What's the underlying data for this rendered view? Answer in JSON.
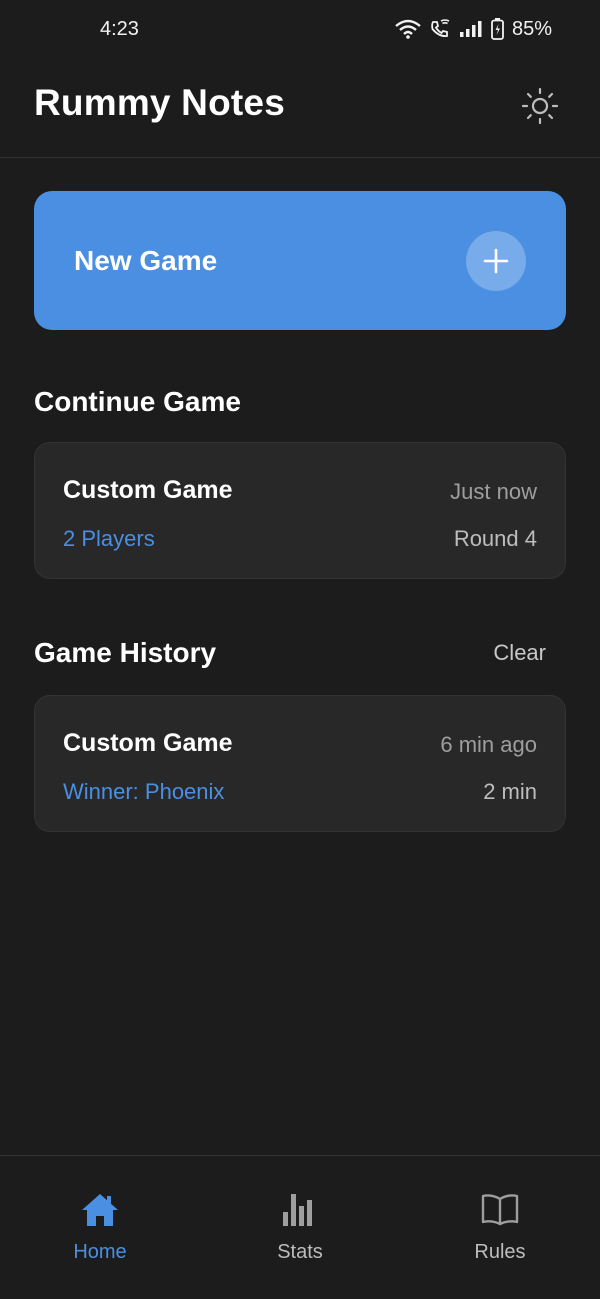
{
  "status_bar": {
    "time": "4:23",
    "battery": "85%"
  },
  "app_bar": {
    "title": "Rummy Notes",
    "theme_icon": "sun-icon"
  },
  "new_game": {
    "label": "New Game",
    "icon": "plus-icon"
  },
  "continue_section": {
    "title": "Continue Game",
    "card": {
      "name": "Custom Game",
      "time": "Just now",
      "players": "2 Players",
      "round": "Round 4"
    }
  },
  "history_section": {
    "title": "Game History",
    "clear_label": "Clear",
    "items": [
      {
        "name": "Custom Game",
        "time": "6 min ago",
        "winner": "Winner: Phoenix",
        "duration": "2 min"
      }
    ]
  },
  "bottom_nav": {
    "items": [
      {
        "label": "Home",
        "icon": "home-icon",
        "active": true
      },
      {
        "label": "Stats",
        "icon": "bar-chart-icon",
        "active": false
      },
      {
        "label": "Rules",
        "icon": "book-icon",
        "active": false
      }
    ]
  },
  "colors": {
    "background": "#1c1c1c",
    "card": "#282828",
    "accent": "#4a8fe2"
  }
}
